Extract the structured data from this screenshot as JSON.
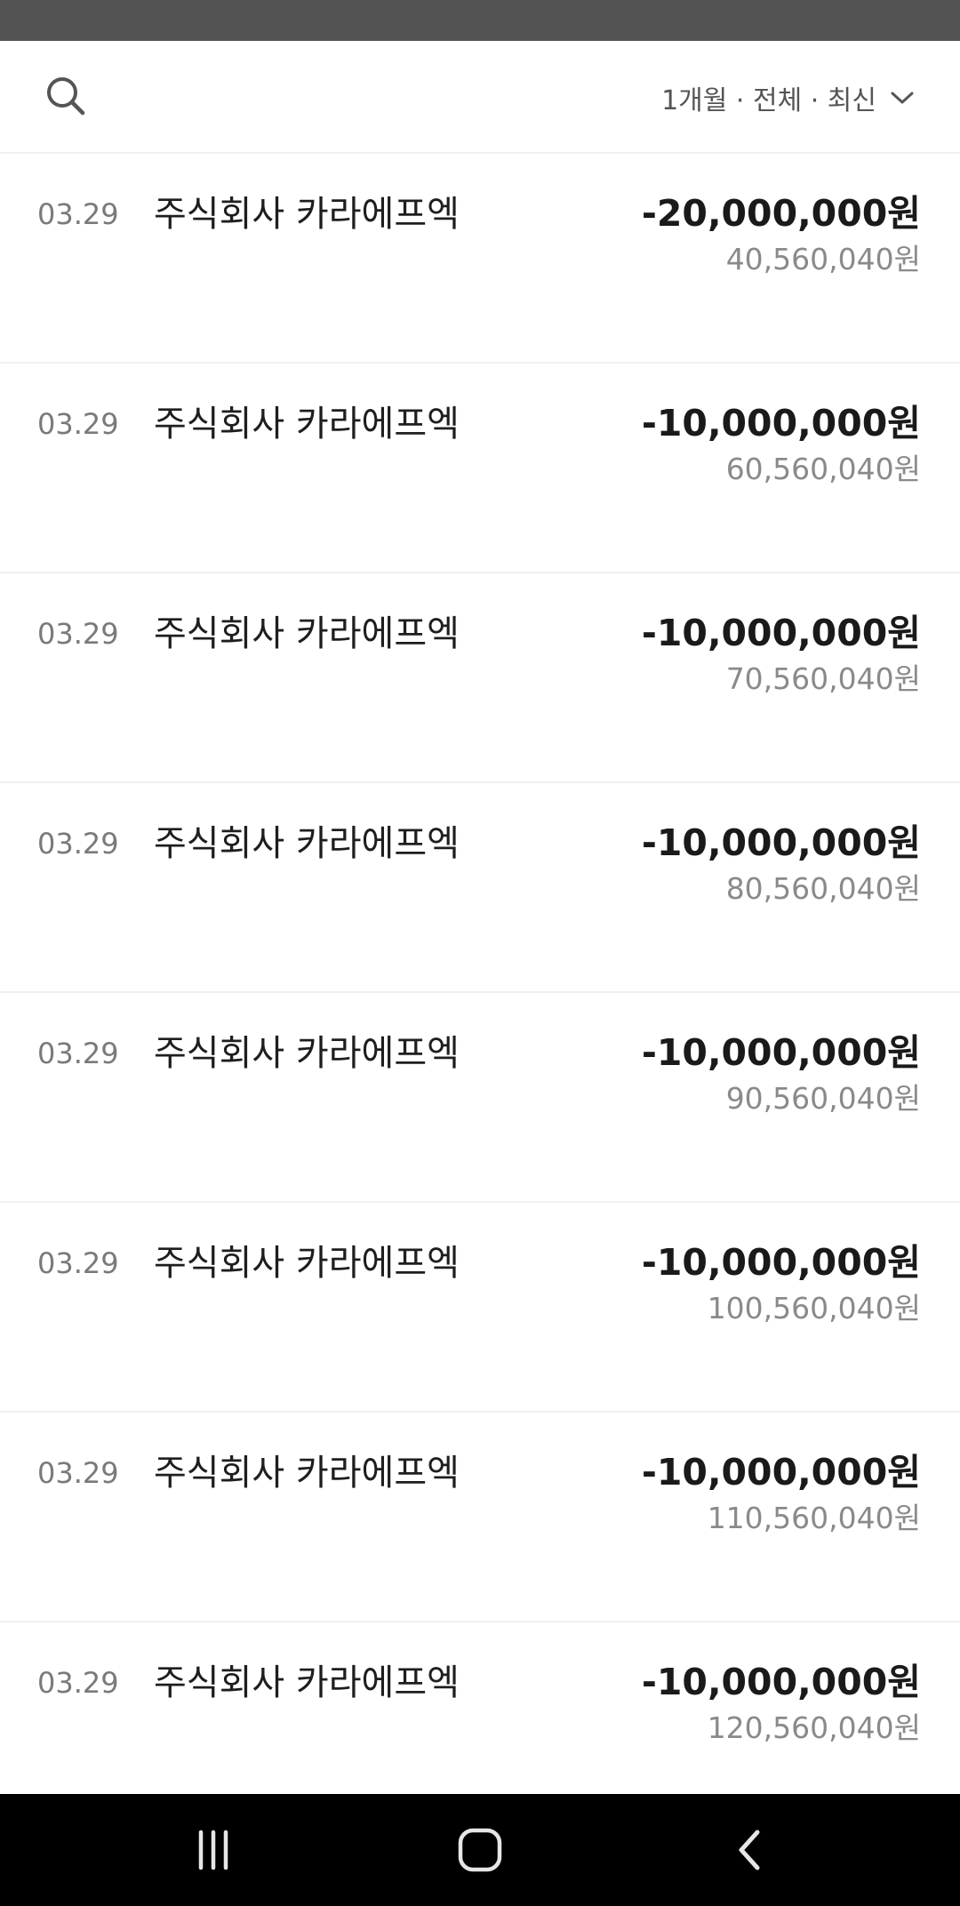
{
  "toolbar": {
    "search_icon": "search-icon",
    "filter_label": "1개월 · 전체 · 최신",
    "filter_icon": "chevron-down-icon"
  },
  "transactions": [
    {
      "date": "03.29",
      "name": "주식회사 카라에프엑",
      "amount": "-20,000,000원",
      "balance": "40,560,040원"
    },
    {
      "date": "03.29",
      "name": "주식회사 카라에프엑",
      "amount": "-10,000,000원",
      "balance": "60,560,040원"
    },
    {
      "date": "03.29",
      "name": "주식회사 카라에프엑",
      "amount": "-10,000,000원",
      "balance": "70,560,040원"
    },
    {
      "date": "03.29",
      "name": "주식회사 카라에프엑",
      "amount": "-10,000,000원",
      "balance": "80,560,040원"
    },
    {
      "date": "03.29",
      "name": "주식회사 카라에프엑",
      "amount": "-10,000,000원",
      "balance": "90,560,040원"
    },
    {
      "date": "03.29",
      "name": "주식회사 카라에프엑",
      "amount": "-10,000,000원",
      "balance": "100,560,040원"
    },
    {
      "date": "03.29",
      "name": "주식회사 카라에프엑",
      "amount": "-10,000,000원",
      "balance": "110,560,040원"
    },
    {
      "date": "03.29",
      "name": "주식회사 카라에프엑",
      "amount": "-10,000,000원",
      "balance": "120,560,040원"
    }
  ],
  "nav": {
    "recents_icon": "recent-apps-icon",
    "home_icon": "home-icon",
    "back_icon": "back-icon"
  },
  "colors": {
    "status_bar": "#535353",
    "nav_bar": "#000000",
    "text_primary": "#1a1a1a",
    "text_secondary": "#8a8a8a"
  }
}
